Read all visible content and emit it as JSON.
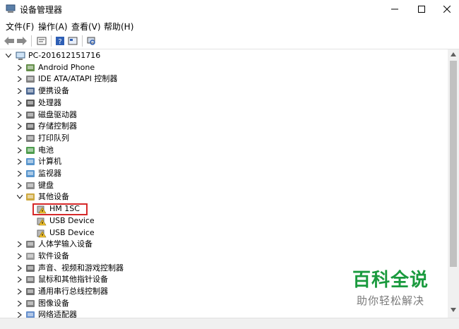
{
  "window": {
    "title": "设备管理器"
  },
  "menu": [
    "文件(F)",
    "操作(A)",
    "查看(V)",
    "帮助(H)"
  ],
  "toolbar_icons": [
    "back-arrow-icon",
    "forward-arrow-icon",
    "properties-icon",
    "help-icon",
    "update-driver-icon",
    "scan-hardware-icon"
  ],
  "tree": {
    "root": "PC-201612151716",
    "items": [
      {
        "label": "Android Phone",
        "icon": "phone-icon"
      },
      {
        "label": "IDE ATA/ATAPI 控制器",
        "icon": "ide-controller-icon"
      },
      {
        "label": "便携设备",
        "icon": "portable-device-icon"
      },
      {
        "label": "处理器",
        "icon": "processor-icon"
      },
      {
        "label": "磁盘驱动器",
        "icon": "disk-drive-icon"
      },
      {
        "label": "存储控制器",
        "icon": "storage-controller-icon"
      },
      {
        "label": "打印队列",
        "icon": "printer-icon"
      },
      {
        "label": "电池",
        "icon": "battery-icon"
      },
      {
        "label": "计算机",
        "icon": "computer-icon"
      },
      {
        "label": "监视器",
        "icon": "monitor-icon"
      },
      {
        "label": "键盘",
        "icon": "keyboard-icon"
      },
      {
        "label": "其他设备",
        "icon": "unknown-device-icon",
        "expanded": true,
        "children": [
          "HM 1SC",
          "USB Device",
          "USB Device"
        ]
      },
      {
        "label": "人体学输入设备",
        "icon": "hid-icon"
      },
      {
        "label": "软件设备",
        "icon": "software-device-icon"
      },
      {
        "label": "声音、视频和游戏控制器",
        "icon": "sound-icon"
      },
      {
        "label": "鼠标和其他指针设备",
        "icon": "mouse-icon"
      },
      {
        "label": "通用串行总线控制器",
        "icon": "usb-icon"
      },
      {
        "label": "图像设备",
        "icon": "imaging-icon"
      },
      {
        "label": "网络适配器",
        "icon": "network-icon"
      }
    ]
  },
  "watermark": {
    "title": "百科全说",
    "subtitle": "助你轻松解决"
  },
  "colors": {
    "highlight": "#d6292a",
    "watermark": "#1a9a3e"
  }
}
